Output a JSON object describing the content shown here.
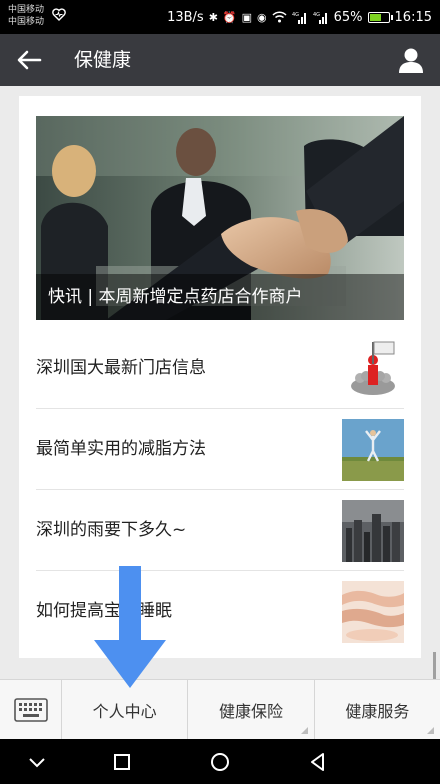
{
  "status_bar": {
    "carrier_1": "中国移动",
    "carrier_2": "中国移动",
    "net_speed": "13B/s",
    "net_label_1": "4G",
    "net_label_2": "4G",
    "battery_text": "65%",
    "battery_level": 0.65,
    "time": "16:15"
  },
  "header": {
    "title": "保健康",
    "back_icon": "arrow-left-icon",
    "profile_icon": "person-icon"
  },
  "hero": {
    "caption": "快讯 | 本周新增定点药店合作商户"
  },
  "news": [
    {
      "title": "深圳国大最新门店信息"
    },
    {
      "title": "最简单实用的减脂方法"
    },
    {
      "title": "深圳的雨要下多久~"
    },
    {
      "title": "如何提高宝宝睡眠"
    }
  ],
  "menu": {
    "keyboard_icon": "keyboard-icon",
    "items": [
      {
        "label": "个人中心"
      },
      {
        "label": "健康保险"
      },
      {
        "label": "健康服务"
      }
    ]
  },
  "colors": {
    "header_bg": "#393a3f",
    "arrow": "#4d90f0",
    "battery": "#7ed321"
  }
}
